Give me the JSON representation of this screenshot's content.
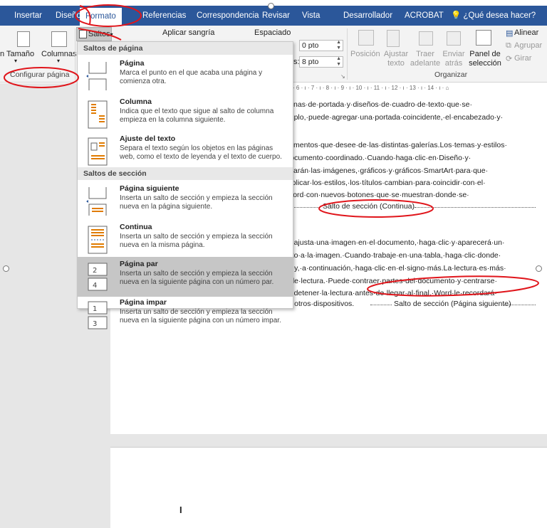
{
  "ribbon_tabs": {
    "insertar": "Insertar",
    "diseno": "Diseño",
    "formato": "Formato",
    "referencias": "Referencias",
    "correspondencia": "Correspondencia",
    "revisar": "Revisar",
    "vista": "Vista",
    "desarrollador": "Desarrollador",
    "acrobat": "ACROBAT",
    "tell_me": "¿Qué desea hacer?"
  },
  "ribbon": {
    "tamano": "Tamaño",
    "columnas": "Columnas",
    "configurar_pagina": "Configurar página",
    "saltos": "Saltos",
    "aplicar_sangria": "Aplicar sangría",
    "espaciado": "Espaciado",
    "spacing_before": "0 pto",
    "spacing_after_label": "s:",
    "spacing_after": "8 pto",
    "posicion": "Posición",
    "ajustar_texto": "Ajustar texto",
    "traer_adelante": "Traer adelante",
    "enviar_atras": "Enviar atrás",
    "panel_seleccion": "Panel de selección",
    "alinear": "Alinear",
    "agrupar": "Agrupar",
    "girar": "Girar",
    "organizar": "Organizar",
    "accent_color": "#2b579a"
  },
  "breaks_menu": {
    "page_breaks_header": "Saltos de página",
    "section_breaks_header": "Saltos de sección",
    "items": [
      {
        "title": "Página",
        "desc": "Marca el punto en el que acaba una página y comienza otra."
      },
      {
        "title": "Columna",
        "desc": "Indica que el texto que sigue al salto de columna empieza en la columna siguiente."
      },
      {
        "title": "Ajuste del texto",
        "desc": "Separa el texto según los objetos en las páginas web, como el texto de leyenda y el texto de cuerpo."
      },
      {
        "title": "Página siguiente",
        "desc": "Inserta un salto de sección y empieza la sección nueva en la página siguiente."
      },
      {
        "title": "Continua",
        "desc": "Inserta un salto de sección y empieza la sección nueva en la misma página."
      },
      {
        "title": "Página par",
        "desc": "Inserta un salto de sección y empieza la sección nueva en la siguiente página con un número par."
      },
      {
        "title": "Página impar",
        "desc": "Inserta un salto de sección y empieza la sección nueva en la siguiente página con un número impar."
      }
    ]
  },
  "ruler": "5 · ı · 6 · ı · 7 · ı · 8 · ı · 9 · ı · 10 · ı · 11 · ı · 12 · ı · 13 · ı · 14 · ı · ⌂",
  "document": {
    "lines_a": [
      "áginas·de·portada·y·diseños·de·cuadro·de·texto·que·se·",
      "emplo,·puede·agregar·una·portada·coincidente,·el·encabezado·y·"
    ],
    "lines_b": [
      "elementos·que·desee·de·las·distintas·galerías.Los·temas·y·estilos·",
      "·documento·coordinado.·Cuando·haga·clic·en·Diseño·y·",
      "nbiarán·las·imágenes,·gráficos·y·gráficos·SmartArt·para·que·",
      "l·aplicar·los·estilos,·los·títulos·cambian·para·coincidir·con·el·",
      "·Word·con·nuevos·botones·que·se·muestran·donde·se·"
    ],
    "break_continuous": "Salto de sección (Continua)",
    "lines_c": [
      "se·ajusta·una·imagen·en·el·documento,·haga·clic·y·aparecerá·un·",
      "unto·a·la·imagen.·Cuando·trabaje·en·una·tabla,·haga·clic·donde·",
      "na·y,·a·continuación,·haga·clic·en·el·signo·más.La·lectura·es·más·",
      "a·de·lectura.·Puede·contraer·partes·del·documento·y·centrarse·",
      "ita·detener·la·lectura·antes·de·llegar·al·final,·Word·le·recordará·",
      "en·otros·dispositivos."
    ],
    "break_next_page": "Salto de sección (Página siguiente)"
  }
}
